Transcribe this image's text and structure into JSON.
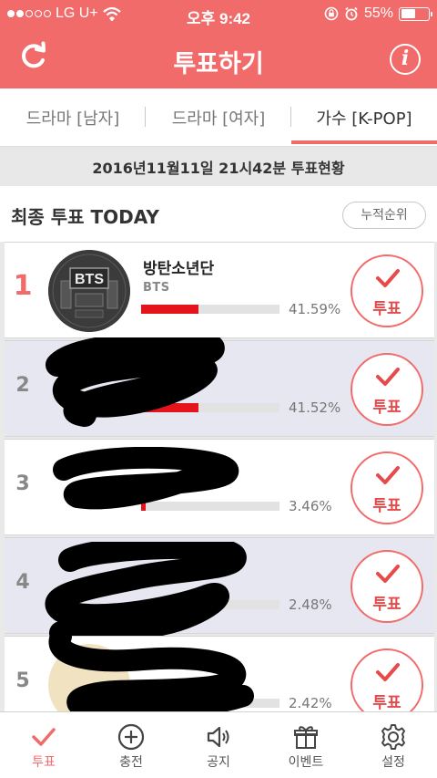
{
  "status_bar": {
    "carrier": "LG U+",
    "time": "오후 9:42",
    "battery": "55%",
    "battery_level": 0.55
  },
  "header": {
    "title": "투표하기",
    "info_symbol": "i"
  },
  "tabs": [
    {
      "label": "드라마 [남자]",
      "active": false
    },
    {
      "label": "드라마 [여자]",
      "active": false
    },
    {
      "label": "가수 [K-POP]",
      "active": true
    }
  ],
  "date_banner": "2016년11월11일 21시42분 투표현황",
  "section": {
    "title": "최종 투표 TODAY",
    "cumulative_button": "누적순위"
  },
  "ranking": [
    {
      "rank": "1",
      "name": "방탄소년단",
      "sub": "BTS",
      "percent": "41.59%",
      "share": 0.4159,
      "vote_label": "투표",
      "logo_text": "BTS"
    },
    {
      "rank": "2",
      "name": "",
      "sub": "",
      "percent": "41.52%",
      "share": 0.4152,
      "vote_label": "투표"
    },
    {
      "rank": "3",
      "name": "",
      "sub": "",
      "percent": "3.46%",
      "share": 0.0346,
      "vote_label": "투표"
    },
    {
      "rank": "4",
      "name": "",
      "sub": "",
      "percent": "2.48%",
      "share": 0.0248,
      "vote_label": "투표"
    },
    {
      "rank": "5",
      "name": "",
      "sub": "",
      "percent": "2.42%",
      "share": 0.0242,
      "vote_label": "투표"
    }
  ],
  "bottom_nav": [
    {
      "label": "투표",
      "icon": "check-icon",
      "active": true
    },
    {
      "label": "충전",
      "icon": "plus-circle-icon",
      "active": false
    },
    {
      "label": "공지",
      "icon": "speaker-icon",
      "active": false
    },
    {
      "label": "이벤트",
      "icon": "gift-icon",
      "active": false
    },
    {
      "label": "설정",
      "icon": "gear-icon",
      "active": false
    }
  ],
  "colors": {
    "accent": "#f26b6b",
    "bar": "#e5141c",
    "shaded_row": "#e6e7f0"
  }
}
